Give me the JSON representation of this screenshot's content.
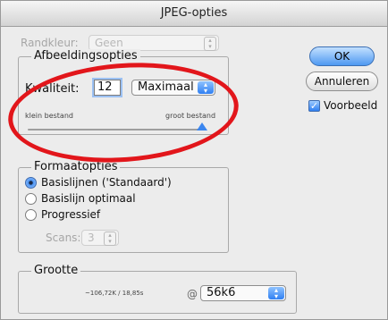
{
  "window": {
    "title": "JPEG-opties"
  },
  "matte": {
    "label": "Randkleur:",
    "value": "Geen"
  },
  "image_options": {
    "title": "Afbeeldingsopties",
    "quality_label": "Kwaliteit:",
    "quality_value": "12",
    "quality_preset": "Maximaal",
    "slider_min_label": "klein bestand",
    "slider_max_label": "groot bestand",
    "slider_level_percent": 100
  },
  "buttons": {
    "ok": "OK",
    "cancel": "Annuleren"
  },
  "preview": {
    "label": "Voorbeeld",
    "checked": true
  },
  "format_options": {
    "title": "Formaatopties",
    "options": [
      {
        "label": "Basislijnen ('Standaard')",
        "selected": true
      },
      {
        "label": "Basislijn optimaal",
        "selected": false
      },
      {
        "label": "Progressief",
        "selected": false
      }
    ],
    "scans_label": "Scans:",
    "scans_value": "3"
  },
  "size": {
    "title": "Grootte",
    "estimate": "~106,72K / 18,85s",
    "at_symbol": "@",
    "speed": "56k6"
  },
  "colors": {
    "accent": "#3b86ef",
    "annotation": "#e2161b"
  }
}
